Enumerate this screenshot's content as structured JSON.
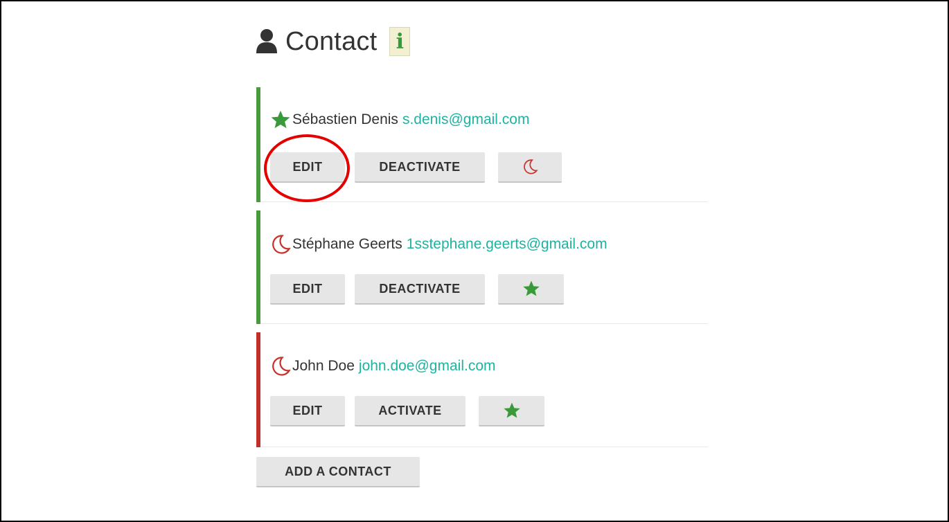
{
  "header": {
    "title": "Contact",
    "person_icon": "user-icon",
    "info_icon_text": "i"
  },
  "colors": {
    "active_bar": "#4a9a3f",
    "inactive_bar": "#c0302a",
    "star": "#3a9a3a",
    "moon": "#c8322a",
    "email": "#20b2a0",
    "annotation": "#e50000"
  },
  "contacts": [
    {
      "name": "Sébastien Denis",
      "email": "s.denis@gmail.com",
      "status_icon": "star-icon",
      "edit_label": "EDIT",
      "toggle_label": "DEACTIVATE",
      "action_icon": "moon-icon",
      "active": true
    },
    {
      "name": "Stéphane Geerts",
      "email": "1sstephane.geerts@gmail.com",
      "status_icon": "moon-icon",
      "edit_label": "EDIT",
      "toggle_label": "DEACTIVATE",
      "action_icon": "star-icon",
      "active": true
    },
    {
      "name": "John Doe",
      "email": "john.doe@gmail.com",
      "status_icon": "moon-icon",
      "edit_label": "EDIT",
      "toggle_label": "ACTIVATE",
      "action_icon": "star-icon",
      "active": false
    }
  ],
  "add_contact_label": "ADD A CONTACT"
}
